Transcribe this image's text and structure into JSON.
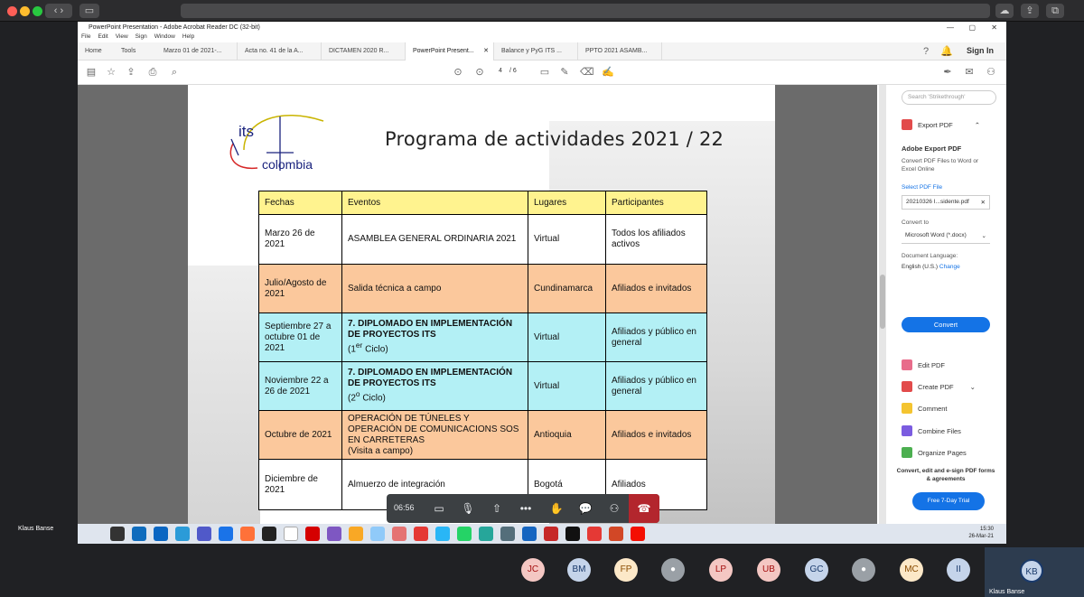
{
  "pdf": {
    "window_title": "PowerPoint Presentation - Adobe Acrobat Reader DC (32-bit)",
    "menu": [
      "File",
      "Edit",
      "View",
      "Sign",
      "Window",
      "Help"
    ],
    "home": "Home",
    "tools": "Tools",
    "tabs": [
      "Marzo 01 de 2021-...",
      "Acta no. 41 de la A...",
      "DICTAMEN 2020 R...",
      "PowerPoint Present...",
      "Balance y PyG ITS ...",
      "PPTO 2021 ASAMB..."
    ],
    "sign_in": "Sign In",
    "page_current": "4",
    "page_total": "/ 6"
  },
  "slide": {
    "title": "Programa de actividades 2021 / 22",
    "logo_its": "its",
    "logo_colombia": "colombia",
    "headers": [
      "Fechas",
      "Eventos",
      "Lugares",
      "Participantes"
    ],
    "rows": [
      {
        "fecha": "Marzo 26 de 2021",
        "evento": "ASAMBLEA GENERAL ORDINARIA 2021",
        "lugar": "Virtual",
        "part": "Todos los afiliados activos"
      },
      {
        "fecha": "Julio/Agosto de 2021",
        "evento": "Salida técnica a campo",
        "lugar": "Cundinamarca",
        "part": "Afiliados e invitados"
      },
      {
        "fecha": "Septiembre 27 a octubre 01 de 2021",
        "evento": "7. DIPLOMADO EN IMPLEMENTACIÓN DE PROYECTOS ITS",
        "evento2": "(1",
        "sup": "er",
        "evento3": " Ciclo)",
        "lugar": "Virtual",
        "part": "Afiliados y público en general"
      },
      {
        "fecha": "Noviembre 22 a 26 de 2021",
        "evento": "7. DIPLOMADO EN IMPLEMENTACIÓN DE PROYECTOS ITS",
        "evento2": "(2",
        "sup": "o",
        "evento3": " Ciclo)",
        "lugar": "Virtual",
        "part": "Afiliados y público en general"
      },
      {
        "fecha": "Octubre de 2021",
        "evento": "OPERACIÓN DE TÚNELES Y OPERACIÓN DE COMUNICACIONS SOS EN CARRETERAS",
        "evento2": "(Visita a campo)",
        "lugar": "Antioquia",
        "part": "Afiliados e invitados"
      },
      {
        "fecha": "Diciembre de 2021",
        "evento": "Almuerzo de integración",
        "lugar": "Bogotá",
        "part": "Afiliados"
      }
    ]
  },
  "panel": {
    "search_placeholder": "Search 'Strikethrough'",
    "export_pdf": "Export PDF",
    "adobe_export": "Adobe Export PDF",
    "export_desc": "Convert PDF Files to Word or Excel Online",
    "select_file": "Select PDF File",
    "file_name": "20210326 I...sidente.pdf",
    "convert_to": "Convert to",
    "format": "Microsoft Word (*.docx)",
    "doc_lang": "Document Language:",
    "lang": "English (U.S.)",
    "change": "Change",
    "convert": "Convert",
    "tools": [
      "Edit PDF",
      "Create PDF",
      "Comment",
      "Combine Files",
      "Organize Pages"
    ],
    "promo": "Convert, edit and e-sign PDF forms & agreements",
    "trial": "Free 7-Day Trial"
  },
  "taskbar": {
    "time": "15:30",
    "date": "26-Mar-21"
  },
  "meet": {
    "timer": "06:56",
    "presenter": "Klaus Banse",
    "participants": [
      "JC",
      "BM",
      "FP",
      "",
      "LP",
      "UB",
      "GC",
      "",
      "MC",
      "II"
    ],
    "self_initials": "KB",
    "self_name": "Klaus Banse"
  },
  "colors": {
    "accent": "#1473e6",
    "header_yellow": "#fff38f",
    "orange_row": "#fbc89c",
    "cyan_row": "#b3f0f5",
    "hangup": "#b3262d"
  }
}
